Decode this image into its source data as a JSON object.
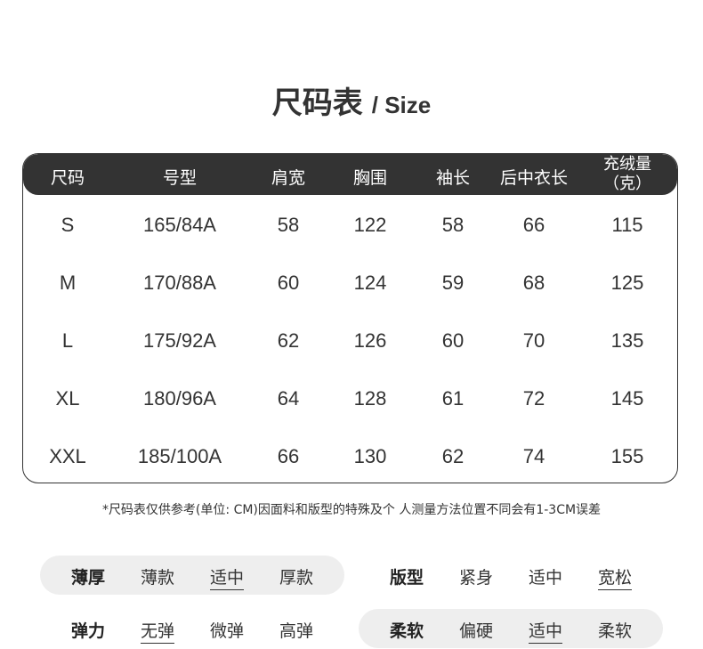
{
  "title": {
    "zh": "尺码表",
    "en": "/ Size"
  },
  "table": {
    "headers": [
      "尺码",
      "号型",
      "肩宽",
      "胸围",
      "袖长",
      "后中衣长",
      "充绒量"
    ],
    "header_extra": "（克）",
    "rows": [
      [
        "S",
        "165/84A",
        "58",
        "122",
        "58",
        "66",
        "115"
      ],
      [
        "M",
        "170/88A",
        "60",
        "124",
        "59",
        "68",
        "125"
      ],
      [
        "L",
        "175/92A",
        "62",
        "126",
        "60",
        "70",
        "135"
      ],
      [
        "XL",
        "180/96A",
        "64",
        "128",
        "61",
        "72",
        "145"
      ],
      [
        "XXL",
        "185/100A",
        "66",
        "130",
        "62",
        "74",
        "155"
      ]
    ]
  },
  "note": "*尺码表仅供参考(单位: CM)因面料和版型的特殊及个 人测量方法位置不同会有1-3CM误差",
  "attributes": [
    {
      "label": "薄厚",
      "options": [
        "薄款",
        "适中",
        "厚款"
      ],
      "selected": "适中"
    },
    {
      "label": "版型",
      "options": [
        "紧身",
        "适中",
        "宽松"
      ],
      "selected": "宽松"
    },
    {
      "label": "弹力",
      "options": [
        "无弹",
        "微弹",
        "高弹"
      ],
      "selected": "无弹"
    },
    {
      "label": "柔软",
      "options": [
        "偏硬",
        "适中",
        "柔软"
      ],
      "selected": "适中"
    }
  ],
  "colors": {
    "header_bg": "#333333",
    "pill_bg": "#eeeeee",
    "text": "#333333"
  }
}
